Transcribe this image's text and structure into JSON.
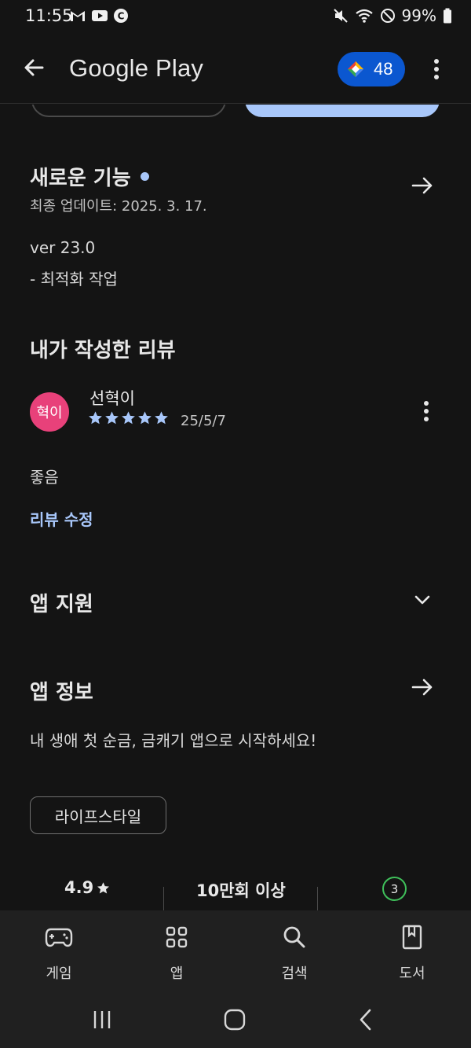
{
  "status_bar": {
    "time": "11:55",
    "battery": "99%",
    "left_icons": [
      "gmail-icon",
      "youtube-icon",
      "c-icon"
    ],
    "right_icons": [
      "mute-icon",
      "wifi-icon",
      "dnd-icon",
      "battery-icon"
    ]
  },
  "header": {
    "title": "Google Play",
    "points": "48"
  },
  "whats_new": {
    "title": "새로운 기능",
    "updated": "최종 업데이트: 2025. 3. 17.",
    "version": "ver 23.0",
    "change": "- 최적화 작업"
  },
  "my_review": {
    "title": "내가 작성한 리뷰",
    "avatar_text": "혁이",
    "reviewer": "선혁이",
    "rating": 5,
    "date": "25/5/7",
    "text": "좋음",
    "edit_label": "리뷰 수정"
  },
  "app_support": {
    "title": "앱 지원"
  },
  "about": {
    "title": "앱 정보",
    "description": "내 생애 첫 순금, 금캐기 앱으로 시작하세요!",
    "category": "라이프스타일"
  },
  "stats": {
    "rating": "4.9",
    "downloads": "10만회 이상",
    "age": "3"
  },
  "bottom_nav": {
    "items": [
      {
        "label": "게임",
        "icon": "gamepad-icon"
      },
      {
        "label": "앱",
        "icon": "apps-grid-icon"
      },
      {
        "label": "검색",
        "icon": "search-icon"
      },
      {
        "label": "도서",
        "icon": "book-icon"
      }
    ]
  },
  "colors": {
    "background": "#141414",
    "accent": "#a8c7fa",
    "chip_blue": "#0b57d0",
    "avatar": "#e8417a",
    "age_ring": "#3fbf5a"
  }
}
